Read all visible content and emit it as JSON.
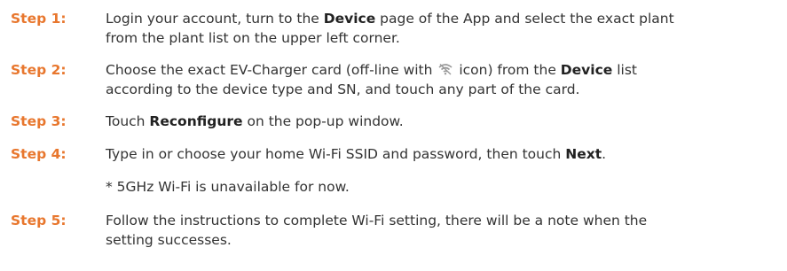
{
  "steps": [
    {
      "label": "Step 1:",
      "parts": [
        "Login your account, turn to the ",
        "Device",
        " page of the App and select the exact plant",
        "from the plant list on the upper left corner."
      ]
    },
    {
      "label": "Step 2:",
      "parts": [
        "Choose the exact EV-Charger card (off-line with ",
        " icon) from the ",
        "Device",
        " list",
        "according to the device type and SN, and touch any part of the card."
      ],
      "icon": "wifi-off-icon"
    },
    {
      "label": "Step 3:",
      "parts": [
        "Touch ",
        "Reconfigure",
        " on the pop-up window."
      ]
    },
    {
      "label": "Step 4:",
      "parts": [
        "Type in or choose your home Wi-Fi SSID and password, then touch ",
        "Next",
        "."
      ],
      "note": "* 5GHz Wi-Fi is unavailable for now."
    },
    {
      "label": "Step 5:",
      "parts": [
        "Follow the instructions to complete Wi-Fi setting, there will be a note when the",
        "setting successes."
      ]
    }
  ],
  "colors": {
    "step_label": "#e8772e",
    "body_text": "#333333"
  }
}
